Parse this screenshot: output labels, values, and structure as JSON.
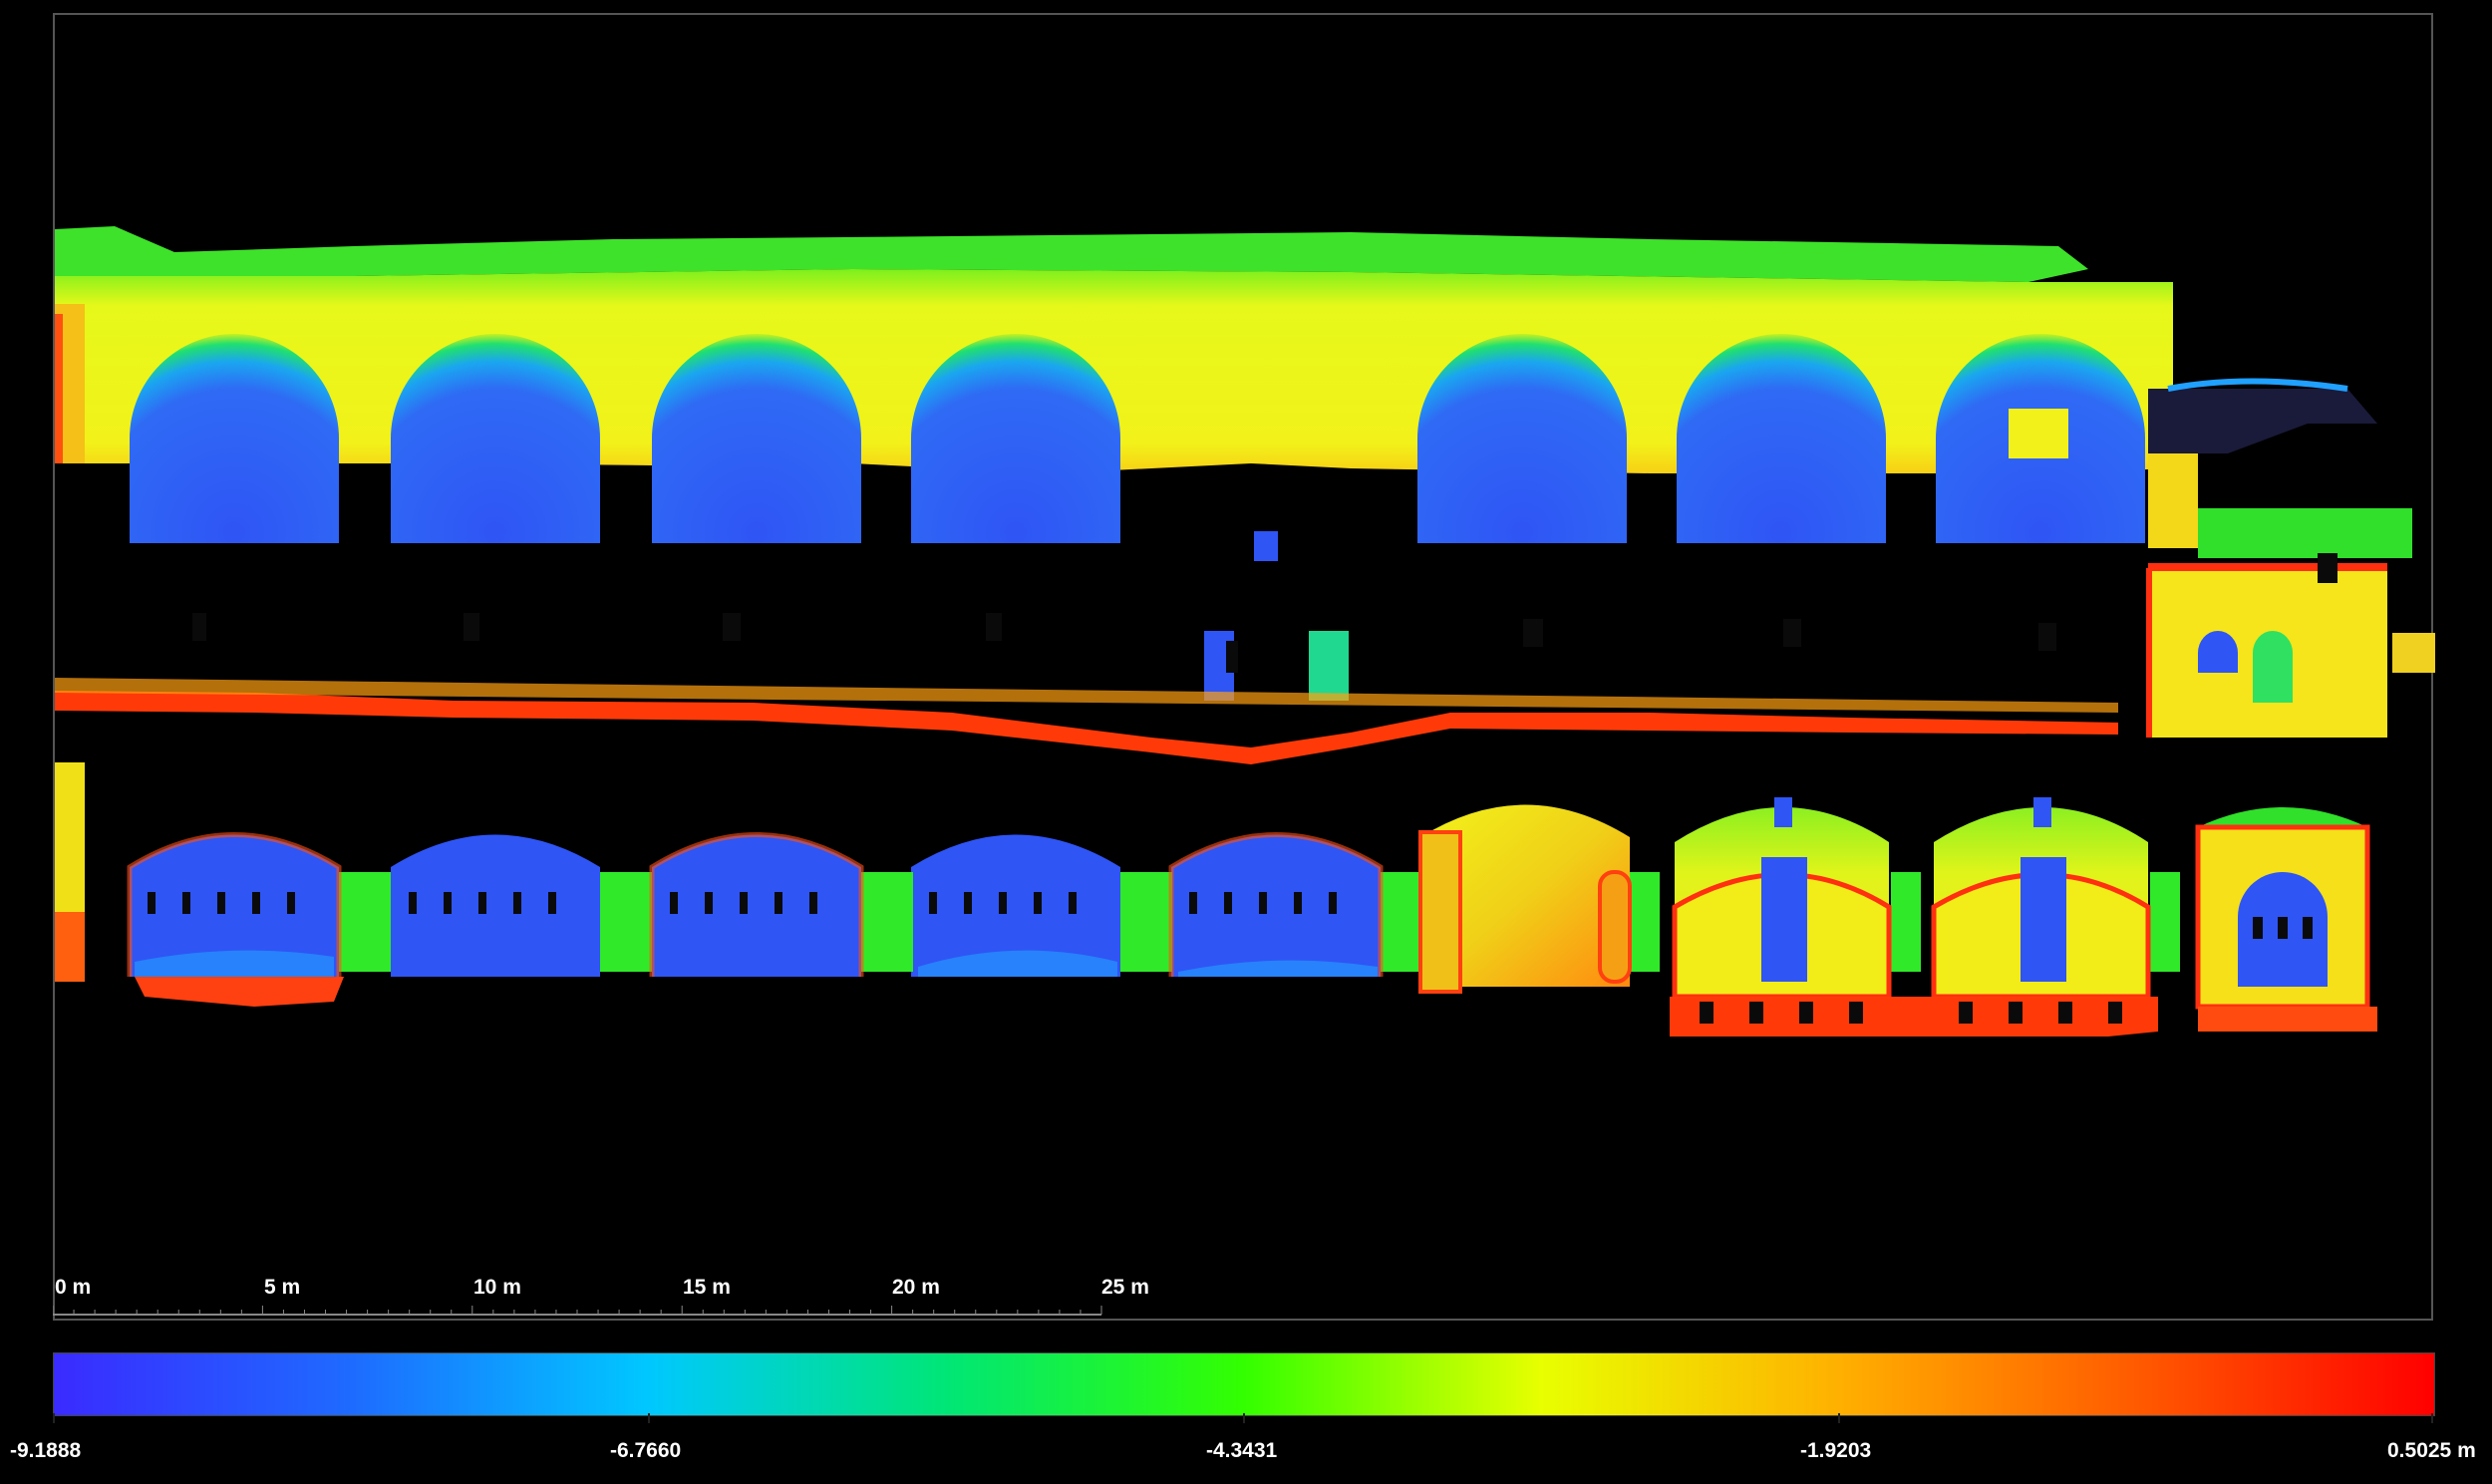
{
  "scale_bar": {
    "labels": [
      "0 m",
      "5 m",
      "10 m",
      "15 m",
      "20 m",
      "25 m"
    ]
  },
  "color_scale": {
    "labels": [
      "-9.1888",
      "-6.7660",
      "-4.3431",
      "-1.9203",
      "0.5025 m"
    ],
    "gradient_stops": [
      "#3a2bff",
      "#1e6bff",
      "#00c8ff",
      "#00e676",
      "#33ff00",
      "#e8ff00",
      "#ffb000",
      "#ff5a00",
      "#ff0000"
    ]
  },
  "palette": {
    "blue": "#2f55f5",
    "cyan": "#00c0ff",
    "green": "#2cf02a",
    "yellow": "#f2f21a",
    "orange": "#ff8c00",
    "red": "#ff2200",
    "dark": "#0a0a0a"
  }
}
